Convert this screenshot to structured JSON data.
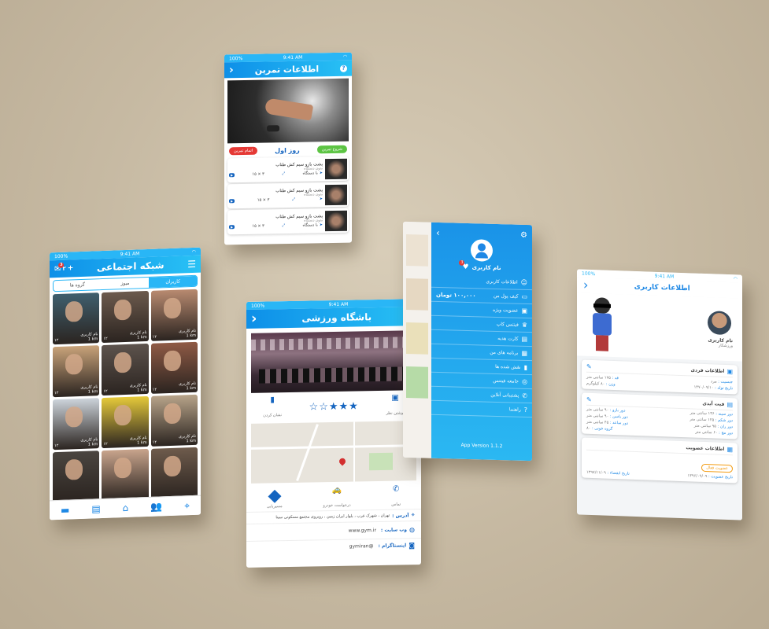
{
  "status": {
    "time": "9:41 AM",
    "battery": "100%"
  },
  "exercise": {
    "title": "اطلاعات تمرین",
    "day": "روز اول",
    "btn_green": "شروع تمرین",
    "btn_red": "اتمام تمرین",
    "items": [
      {
        "name": "پشت بازو سیم کش طناب",
        "equip": "بدون دستگاه",
        "mode": "با دستگاه",
        "sets": "۳ × ۱۵",
        "count": "۱"
      },
      {
        "name": "پشت بازو سیم کش طناب",
        "equip": "بدون دستگاه",
        "mode": "",
        "sets": "۳ × ۱۵",
        "count": "۱"
      },
      {
        "name": "پشت بازو سیم کش طناب",
        "equip": "بدون دستگاه",
        "mode": "با دستگاه",
        "sets": "۳ × ۱۵",
        "count": "۱"
      }
    ]
  },
  "social": {
    "title": "شبکه اجتماعی",
    "tabs": [
      "کاربران",
      "میوز",
      "گروه ها"
    ],
    "username": "نام کاربری",
    "distance": "1 km",
    "photos": "۱۲",
    "badge": "3",
    "users_count": "۲",
    "tile_colors": [
      "#b88a70",
      "#6c5a4d",
      "#3f5f6e",
      "#8f5a45",
      "#5d534d",
      "#c9a37a",
      "#b8a48a",
      "#e5c93a",
      "#ccd3da",
      "#6e5b4c",
      "#c8a48c",
      "#4a4540"
    ]
  },
  "gym": {
    "title": "باشگاه ورزشی",
    "actions": [
      "نشان کردن",
      "",
      "نوشتن نظر"
    ],
    "rating": "3.5",
    "map_actions": [
      "تماس",
      "درخواست خودرو",
      "مسیریابی"
    ],
    "address_label": "آدرس :",
    "address": "تهران ، شهرک غرب ، بلوار ایران زمین ، روبروی مجتمع مسکونی سینا",
    "website_label": "وب سایت :",
    "website": "www.gym.ir",
    "instagram_label": "اینستاگرام :",
    "instagram": "@gymiran"
  },
  "menu": {
    "username": "نام کاربری",
    "balance": "۱۰۰,۰۰۰ تومان",
    "items": [
      "اطلاعات کاربری",
      "کیف پول من",
      "عضویت ویژه",
      "فیتنس کاپ",
      "کارت هدیه",
      "برنامه های من",
      "نقش شده ها",
      "جامعه فیتنس",
      "پشتیبانی آنلاین",
      "راهنما"
    ],
    "version": "App Version 1.1.2",
    "badge": "3"
  },
  "profile": {
    "title": "اطلاعات کاربری",
    "username": "نام کاربری",
    "role": "ورزشکار",
    "personal_title": "اطلاعات فردی",
    "gender_label": "جنسیت :",
    "gender": "مرد",
    "height_label": "قد :",
    "height": "۱۷۵ سانتی متر",
    "weight_label": "وزن :",
    "weight": "۸۰ کیلوگرم",
    "birth_label": "تاریخ تولد :",
    "birth": "۱۳۷۰/۰۹/۱۰",
    "fit_title": "فیت آیدی",
    "fit_rows": [
      {
        "a_label": "دور سینه :",
        "a": "۱۳۶ سانتی متر",
        "b_label": "دور بازو :",
        "b": "۹۰ سانتی متر"
      },
      {
        "a_label": "دور شکم :",
        "a": "۱۲۵ سانتی متر",
        "b_label": "دور باسن :",
        "b": "۹۰ سانتی متر"
      },
      {
        "a_label": "دور ران :",
        "a": "۹۵ سانتی متر",
        "b_label": "دور ساعد :",
        "b": "۴۵ سانتی متر"
      },
      {
        "a_label": "دور مچ :",
        "a": "۶۰ سانتی متر",
        "b_label": "گروه خونی :",
        "b": "۸۰"
      }
    ],
    "member_title": "اطلاعات عضویت",
    "member_badge": "عضویت فعال",
    "member_date_label": "تاریخ عضویت :",
    "member_date": "۱۳۹۶/۰۹/۰۹",
    "expire_label": "تاریخ انقضاء :",
    "expire": "۱۳۹۷/۱۱/۰۹"
  }
}
